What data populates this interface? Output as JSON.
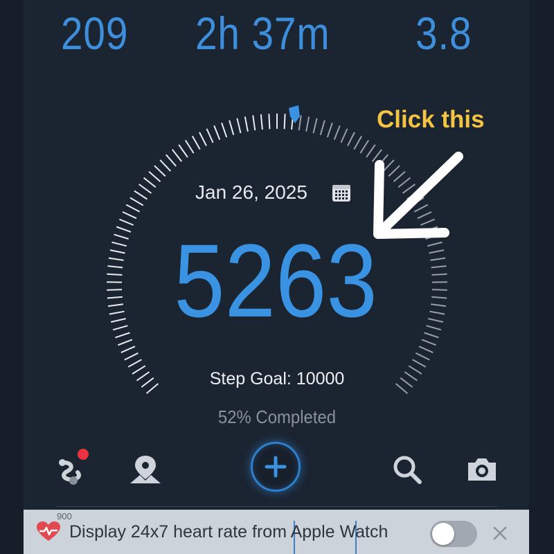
{
  "stats": {
    "calories": "209",
    "duration": "2h 37m",
    "distance": "3.8"
  },
  "dial": {
    "date": "Jan 26, 2025",
    "steps": "5263",
    "goal": "Step Goal: 10000",
    "completed": "52% Completed",
    "progress": 0.5263
  },
  "annotation": {
    "text": "Click this",
    "color": "#f6c443"
  },
  "toolbar": {
    "items": [
      "route-icon",
      "map-pin-icon",
      "add-icon",
      "search-icon",
      "camera-icon"
    ],
    "has_notification": true
  },
  "banner": {
    "chart_label": "900",
    "text": "Display 24x7 heart rate from Apple Watch",
    "toggle_on": false
  },
  "colors": {
    "accent": "#3a93e2",
    "background": "#1b2431",
    "notification": "#e8343f"
  }
}
